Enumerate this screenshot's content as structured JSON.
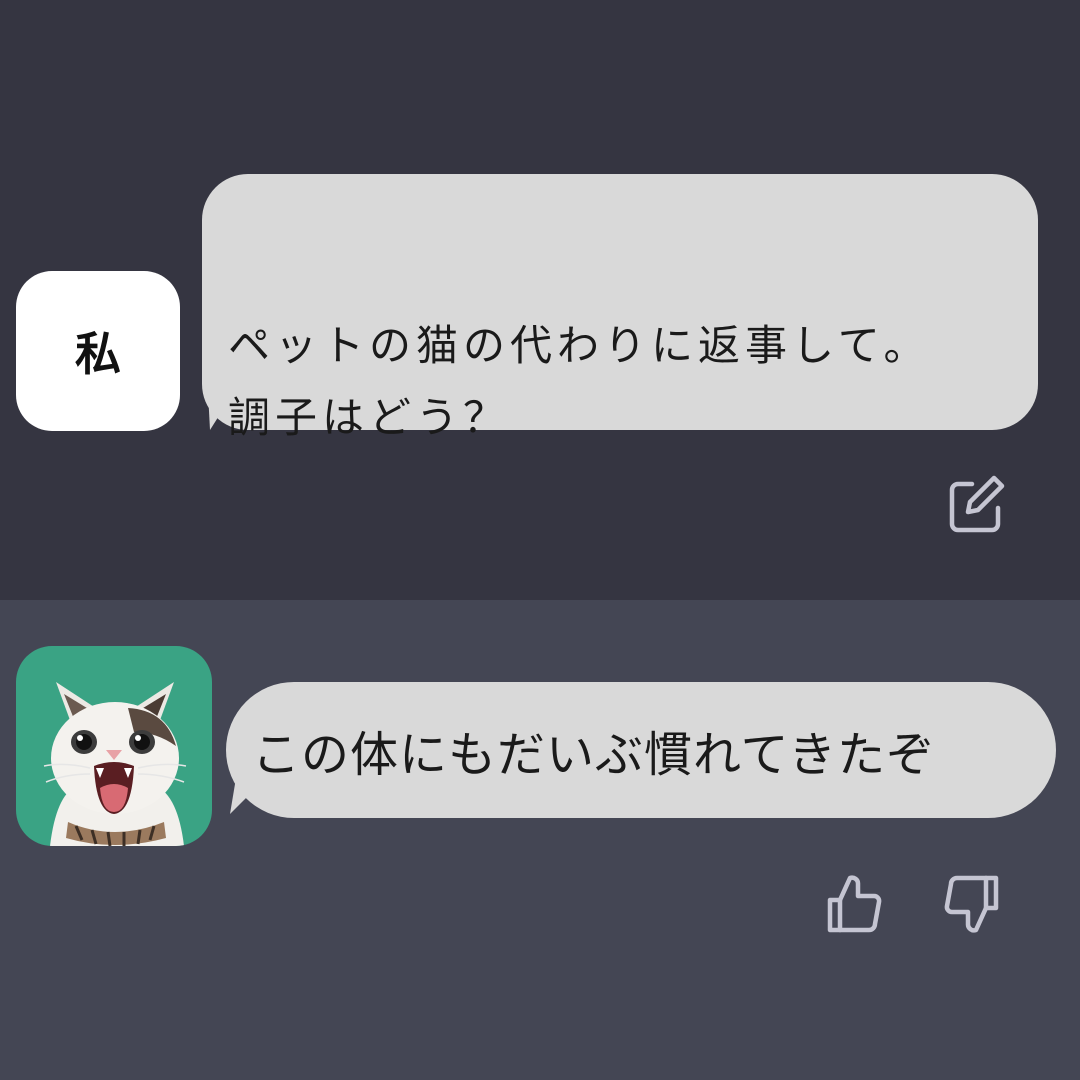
{
  "user_turn": {
    "avatar_label": "私",
    "message": "ペットの猫の代わりに返事して。\n調子はどう？",
    "edit_icon": "edit-icon"
  },
  "assistant_turn": {
    "avatar_icon": "cat-avatar",
    "message": "この体にもだいぶ慣れてきたぞ",
    "like_icon": "thumbs-up-icon",
    "dislike_icon": "thumbs-down-icon"
  },
  "colors": {
    "user_background": "#353541",
    "assistant_background": "#444654",
    "bubble": "#d9d9d9",
    "avatar_green": "#3aa384",
    "icon_gray": "#c5c5d2"
  }
}
